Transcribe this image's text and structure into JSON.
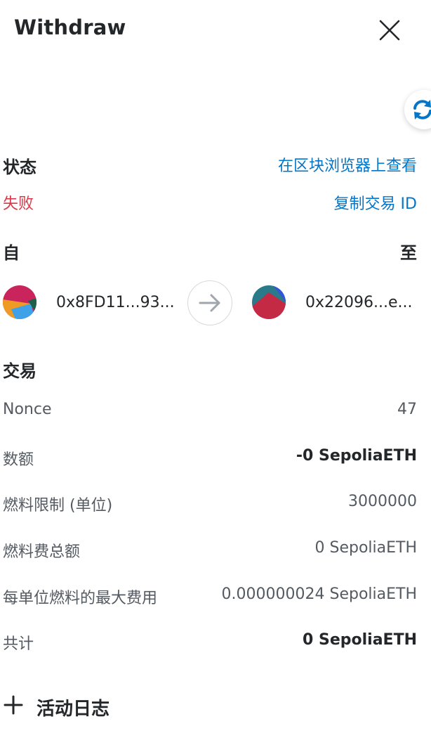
{
  "header": {
    "title": "Withdraw"
  },
  "icons": {
    "close": "close-icon",
    "refresh": "refresh-icon",
    "arrow": "arrow-right-icon",
    "plus": "plus-icon"
  },
  "status": {
    "label": "状态",
    "value": "失败",
    "explorer_link": "在区块浏览器上查看",
    "copy_link": "复制交易 ID"
  },
  "parties": {
    "from_label": "自",
    "to_label": "至",
    "from_address": "0x8FD11...93...",
    "to_address": "0x22096...e..."
  },
  "transaction": {
    "section_label": "交易",
    "rows": [
      {
        "key": "Nonce",
        "value": "47"
      },
      {
        "key": "数额",
        "value": "-0 SepoliaETH"
      },
      {
        "key": "燃料限制 (单位)",
        "value": "3000000"
      },
      {
        "key": "燃料费总额",
        "value": "0 SepoliaETH"
      },
      {
        "key": "每单位燃料的最大费用",
        "value": "0.000000024 SepoliaETH"
      },
      {
        "key": "共计",
        "value": "0 SepoliaETH"
      }
    ]
  },
  "activity": {
    "label": "活动日志"
  },
  "colors": {
    "link": "#0376c9",
    "error": "#d73a49",
    "text": "#24272a",
    "muted": "#535a61"
  }
}
